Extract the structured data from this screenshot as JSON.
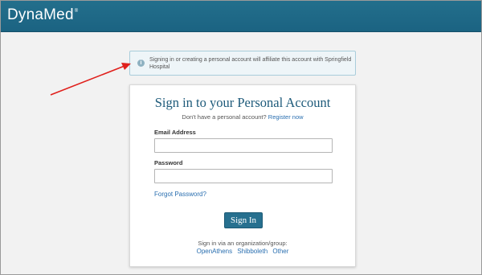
{
  "header": {
    "logo_text": "DynaMed",
    "trademark": "®",
    "bar_color": "#1e6886"
  },
  "notice": {
    "icon": "info-icon",
    "text": "Signing in or creating a personal account will affiliate this account with Springfield Hospital"
  },
  "annotation": {
    "arrow_color": "#e0201c"
  },
  "signin_card": {
    "title": "Sign in to your Personal Account",
    "register_prompt": "Don't have a personal account?",
    "register_link": "Register now",
    "email_label": "Email Address",
    "email_value": "",
    "password_label": "Password",
    "password_value": "",
    "forgot_link": "Forgot Password?",
    "signin_button": "Sign In",
    "org_prompt": "Sign in via an organization/group:",
    "org_links": [
      "OpenAthens",
      "Shibboleth",
      "Other"
    ]
  }
}
